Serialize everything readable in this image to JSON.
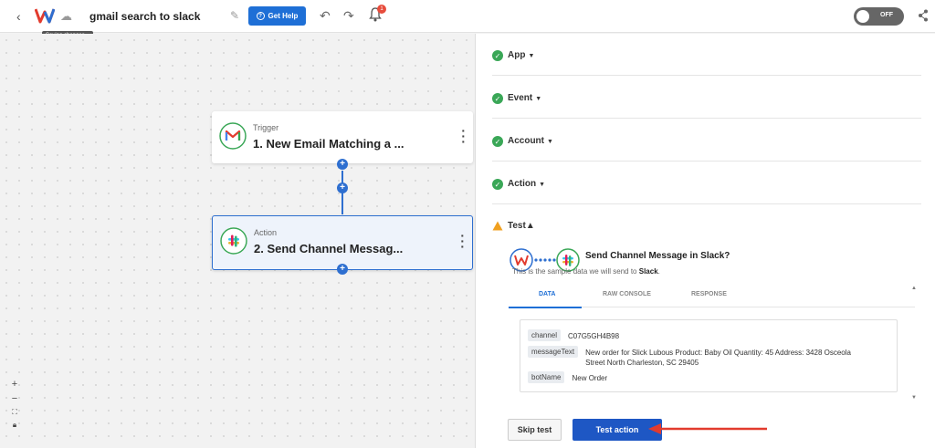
{
  "topbar": {
    "title": "gmail search to slack",
    "saving_tooltip": "Saving changes...",
    "help_label": "Get Help",
    "notification_count": "1",
    "toggle_label": "OFF"
  },
  "canvas": {
    "trigger": {
      "kind": "Trigger",
      "name": "1. New Email Matching a ..."
    },
    "action": {
      "kind": "Action",
      "name": "2. Send Channel Messag..."
    }
  },
  "panel": {
    "sections": [
      {
        "label": "App",
        "status": "complete"
      },
      {
        "label": "Event",
        "status": "complete"
      },
      {
        "label": "Account",
        "status": "complete"
      },
      {
        "label": "Action",
        "status": "complete"
      }
    ],
    "test": {
      "label": "Test",
      "connection_title": "Send Channel Message in Slack?",
      "subtitle_prefix": "This is the sample data we will send to",
      "subtitle_target": "Slack",
      "tabs": [
        {
          "label": "DATA",
          "active": true
        },
        {
          "label": "RAW CONSOLE",
          "active": false
        },
        {
          "label": "RESPONSE",
          "active": false
        }
      ],
      "fields": [
        {
          "key": "channel",
          "value": "C07G5GH4B98"
        },
        {
          "key": "messageText",
          "value": "New order for Slick Lubous Product: Baby Oil Quantity: 45 Address: 3428 Osceola Street North Charleston, SC 29405"
        },
        {
          "key": "botName",
          "value": "New Order"
        }
      ],
      "skip_label": "Skip test",
      "test_label": "Test action"
    }
  },
  "colors": {
    "accent": "#1e6fd6",
    "success": "#3aa757",
    "warning": "#f0a020",
    "annotation_arrow": "#e23b2e"
  }
}
